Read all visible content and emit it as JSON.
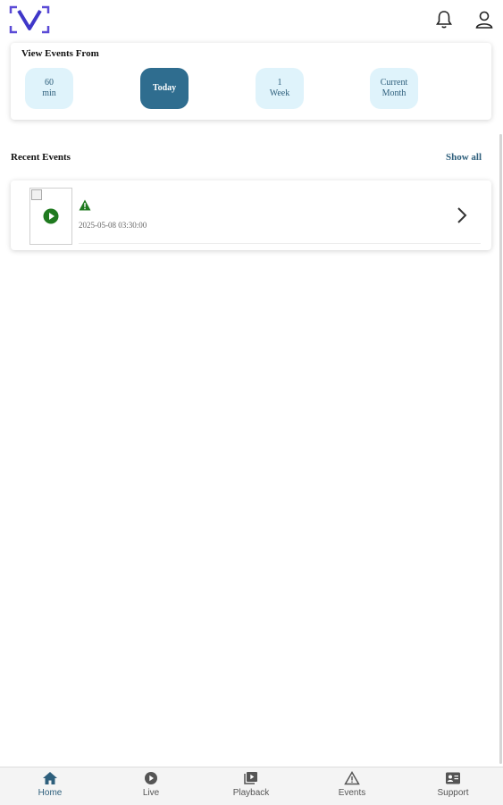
{
  "header": {
    "logo_icon": "v-logo-icon",
    "notifications_icon": "bell-icon",
    "profile_icon": "user-icon",
    "brand_color": "#5b4bd6"
  },
  "filter": {
    "title": "View Events From",
    "options": [
      {
        "label": "60\nmin",
        "active": false
      },
      {
        "label": "Today",
        "active": true
      },
      {
        "label": "1\nWeek",
        "active": false
      },
      {
        "label": "Current\nMonth",
        "active": false
      }
    ],
    "active_color": "#2f6d8f",
    "inactive_color": "#dff3fb"
  },
  "recent": {
    "title": "Recent Events",
    "show_all": "Show all",
    "events": [
      {
        "thumbnail_icon": "broken-image-icon",
        "play_icon": "play-circle-icon",
        "status_icon": "warning-icon",
        "timestamp": "2025-05-08 03:30:00"
      }
    ]
  },
  "nav": {
    "items": [
      {
        "label": "Home",
        "icon": "home-icon",
        "active": true
      },
      {
        "label": "Live",
        "icon": "play-circle-icon",
        "active": false
      },
      {
        "label": "Playback",
        "icon": "playback-icon",
        "active": false
      },
      {
        "label": "Events",
        "icon": "warning-icon",
        "active": false
      },
      {
        "label": "Support",
        "icon": "support-icon",
        "active": false
      }
    ]
  }
}
